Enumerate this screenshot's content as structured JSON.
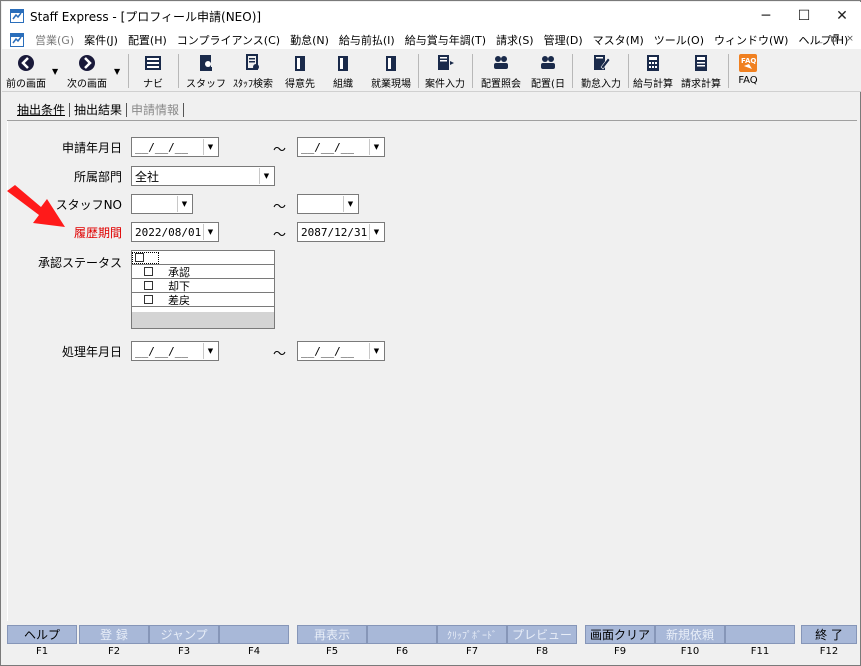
{
  "window": {
    "title": "Staff Express - [プロフィール申請(NEO)]",
    "controls": [
      "─",
      "☐",
      "✕"
    ],
    "mdi_controls": [
      "_",
      "🗗",
      "×"
    ]
  },
  "menu": [
    {
      "label": "営業(G)",
      "enabled": false
    },
    {
      "label": "案件(J)",
      "enabled": true
    },
    {
      "label": "配置(H)",
      "enabled": true
    },
    {
      "label": "コンプライアンス(C)",
      "enabled": true
    },
    {
      "label": "勤怠(N)",
      "enabled": true
    },
    {
      "label": "給与前払(I)",
      "enabled": true
    },
    {
      "label": "給与賞与年調(T)",
      "enabled": true
    },
    {
      "label": "請求(S)",
      "enabled": true
    },
    {
      "label": "管理(D)",
      "enabled": true
    },
    {
      "label": "マスタ(M)",
      "enabled": true
    },
    {
      "label": "ツール(O)",
      "enabled": true
    },
    {
      "label": "ウィンドウ(W)",
      "enabled": true
    },
    {
      "label": "ヘルプ(H)",
      "enabled": true
    }
  ],
  "toolbar": {
    "back": "前の画面",
    "next": "次の画面",
    "navi": "ナビ",
    "staff": "スタッフ",
    "staff_search": "ｽﾀｯﾌ検索",
    "client": "得意先",
    "org": "組織",
    "worksite": "就業現場",
    "case_input": "案件入力",
    "placement_query": "配置照会",
    "placement_day": "配置(日",
    "attendance_input": "勤怠入力",
    "payroll_calc": "給与計算",
    "billing_calc": "請求計算",
    "faq": "FAQ",
    "faq_icon_text": "FAQ"
  },
  "tabs": [
    {
      "label": "抽出条件",
      "state": "active"
    },
    {
      "label": "抽出結果",
      "state": "normal"
    },
    {
      "label": "申請情報",
      "state": "inactive"
    }
  ],
  "form": {
    "apply_date": {
      "label": "申請年月日",
      "from": "__/__/__",
      "to": "__/__/__"
    },
    "department": {
      "label": "所属部門",
      "value": "全社"
    },
    "staff_no": {
      "label": "スタッフNO",
      "from": "",
      "to": ""
    },
    "history_period": {
      "label": "履歴期間",
      "from": "2022/08/01",
      "to": "2087/12/31"
    },
    "approval_status": {
      "label": "承認ステータス",
      "options": [
        {
          "label": "",
          "checked": false
        },
        {
          "label": "承認",
          "checked": false
        },
        {
          "label": "却下",
          "checked": false
        },
        {
          "label": "差戻",
          "checked": false
        }
      ]
    },
    "process_date": {
      "label": "処理年月日",
      "from": "__/__/__",
      "to": "__/__/__"
    },
    "range_sep": "～"
  },
  "fkeys": [
    {
      "label": "ヘルプ",
      "key": "F1",
      "enabled": true
    },
    {
      "label": "登 録",
      "key": "F2",
      "enabled": false
    },
    {
      "label": "ジャンプ",
      "key": "F3",
      "enabled": false
    },
    {
      "label": "",
      "key": "F4",
      "enabled": false
    },
    {
      "label": "再表示",
      "key": "F5",
      "enabled": false
    },
    {
      "label": "",
      "key": "F6",
      "enabled": false
    },
    {
      "label": "ｸﾘｯﾌﾟﾎﾞｰﾄﾞ",
      "key": "F7",
      "enabled": false
    },
    {
      "label": "プレビュー",
      "key": "F8",
      "enabled": false
    },
    {
      "label": "画面クリア",
      "key": "F9",
      "enabled": true
    },
    {
      "label": "新規依頼",
      "key": "F10",
      "enabled": false
    },
    {
      "label": "",
      "key": "F11",
      "enabled": false
    },
    {
      "label": "終 了",
      "key": "F12",
      "enabled": true
    }
  ],
  "colors": {
    "accent_red": "#e00000",
    "fkey_bg": "#a8b8d8",
    "faq_orange": "#f08020"
  }
}
